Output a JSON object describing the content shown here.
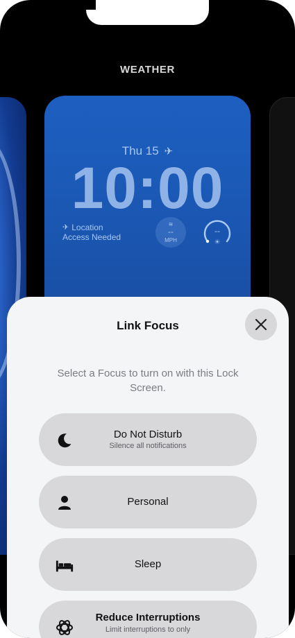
{
  "header": {
    "title": "WEATHER"
  },
  "lock_screen": {
    "date": "Thu 15",
    "time": "10:00",
    "location_line1": "Location",
    "location_line2": "Access Needed",
    "wind_value": "--",
    "wind_unit": "MPH",
    "uv_value": "--"
  },
  "sheet": {
    "title": "Link Focus",
    "subtitle": "Select a Focus to turn on with this Lock Screen.",
    "options": [
      {
        "label": "Do Not Disturb",
        "sublabel": "Silence all notifications",
        "icon": "moon-icon"
      },
      {
        "label": "Personal",
        "sublabel": "",
        "icon": "person-icon"
      },
      {
        "label": "Sleep",
        "sublabel": "",
        "icon": "bed-icon"
      },
      {
        "label": "Reduce Interruptions",
        "sublabel": "Limit interruptions to only",
        "icon": "interruptions-icon"
      }
    ]
  },
  "colors": {
    "lock_bg": "#1d5fc0",
    "sheet_bg": "#f4f5f7",
    "option_bg": "#d8d8da"
  }
}
